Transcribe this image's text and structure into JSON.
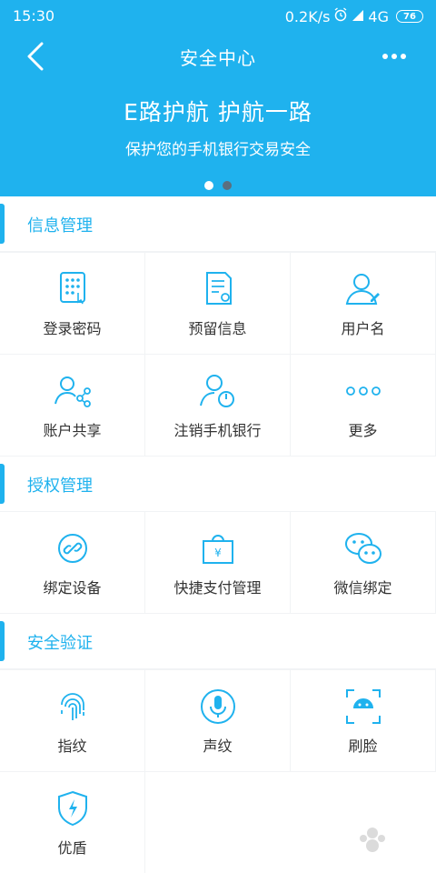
{
  "status": {
    "time": "15:30",
    "speed": "0.2K/s",
    "network": "4G",
    "battery": "76"
  },
  "header": {
    "title": "安全中心"
  },
  "banner": {
    "title": "E路护航 护航一路",
    "subtitle": "保护您的手机银行交易安全"
  },
  "sections": {
    "info": {
      "title": "信息管理",
      "items": [
        {
          "label": "登录密码",
          "icon": "keypad-icon"
        },
        {
          "label": "预留信息",
          "icon": "document-settings-icon"
        },
        {
          "label": "用户名",
          "icon": "user-edit-icon"
        },
        {
          "label": "账户共享",
          "icon": "user-share-icon"
        },
        {
          "label": "注销手机银行",
          "icon": "user-power-icon"
        },
        {
          "label": "更多",
          "icon": "more-dots-icon"
        }
      ]
    },
    "auth": {
      "title": "授权管理",
      "items": [
        {
          "label": "绑定设备",
          "icon": "link-icon"
        },
        {
          "label": "快捷支付管理",
          "icon": "payment-bag-icon"
        },
        {
          "label": "微信绑定",
          "icon": "wechat-icon"
        }
      ]
    },
    "verify": {
      "title": "安全验证",
      "items": [
        {
          "label": "指纹",
          "icon": "fingerprint-icon"
        },
        {
          "label": "声纹",
          "icon": "microphone-icon"
        },
        {
          "label": "刷脸",
          "icon": "face-scan-icon"
        },
        {
          "label": "优盾",
          "icon": "shield-bolt-icon"
        }
      ]
    }
  },
  "colors": {
    "primary": "#1fb2ee",
    "background": "#f1f3f5"
  }
}
